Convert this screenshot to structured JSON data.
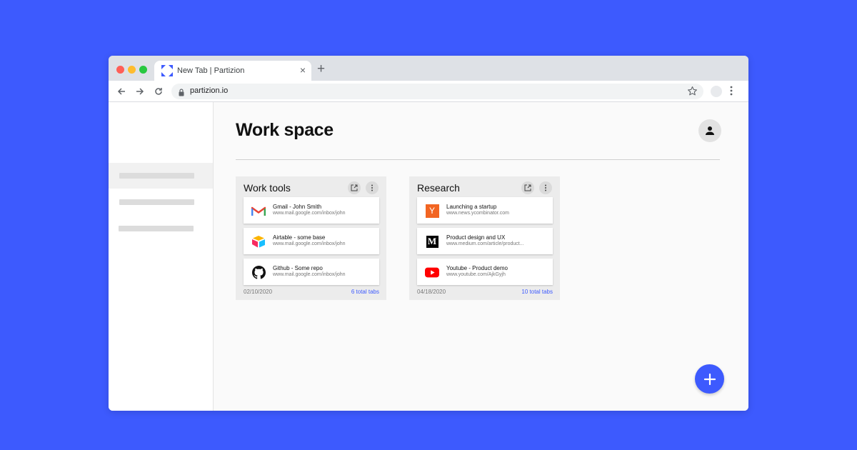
{
  "browser": {
    "tab_title": "New Tab | Partizion",
    "tab_close": "×",
    "new_tab": "+",
    "url": "partizion.io"
  },
  "icons": {
    "tab_favicon": "partizion-logo-icon",
    "back": "arrow-left-icon",
    "forward": "arrow-right-icon",
    "reload": "reload-icon",
    "lock": "lock-icon",
    "star": "star-icon",
    "menu": "kebab-menu-icon",
    "avatar": "user-icon",
    "open": "open-external-icon",
    "more": "more-vertical-icon",
    "fab": "plus-icon"
  },
  "main": {
    "title": "Work space"
  },
  "groups": [
    {
      "title": "Work tools",
      "date": "02/10/2020",
      "count": "6 total tabs",
      "tabs": [
        {
          "title": "Gmail - John Smith",
          "url": "www.mail.google.com/inbox/john",
          "icon": "gmail-icon"
        },
        {
          "title": "Airtable - some base",
          "url": "www.mail.google.com/inbox/john",
          "icon": "airtable-icon"
        },
        {
          "title": "Github - Some repo",
          "url": "www.mail.google.com/inbox/john",
          "icon": "github-icon"
        }
      ]
    },
    {
      "title": "Research",
      "date": "04/18/2020",
      "count": "10 total tabs",
      "tabs": [
        {
          "title": "Launching a startup",
          "url": "www.news.ycombinator.com",
          "icon": "ycombinator-icon",
          "icon_text": "Y"
        },
        {
          "title": "Product design and UX",
          "url": "www.medium.com/article/product...",
          "icon": "medium-icon",
          "icon_text": "M"
        },
        {
          "title": "Youtube - Product demo",
          "url": "www.youtube.com/AjkGyjh",
          "icon": "youtube-icon"
        }
      ]
    }
  ],
  "colors": {
    "background": "#3d5afe",
    "accent": "#3d5afe",
    "ycombinator": "#f26522",
    "youtube": "#ff0000"
  }
}
